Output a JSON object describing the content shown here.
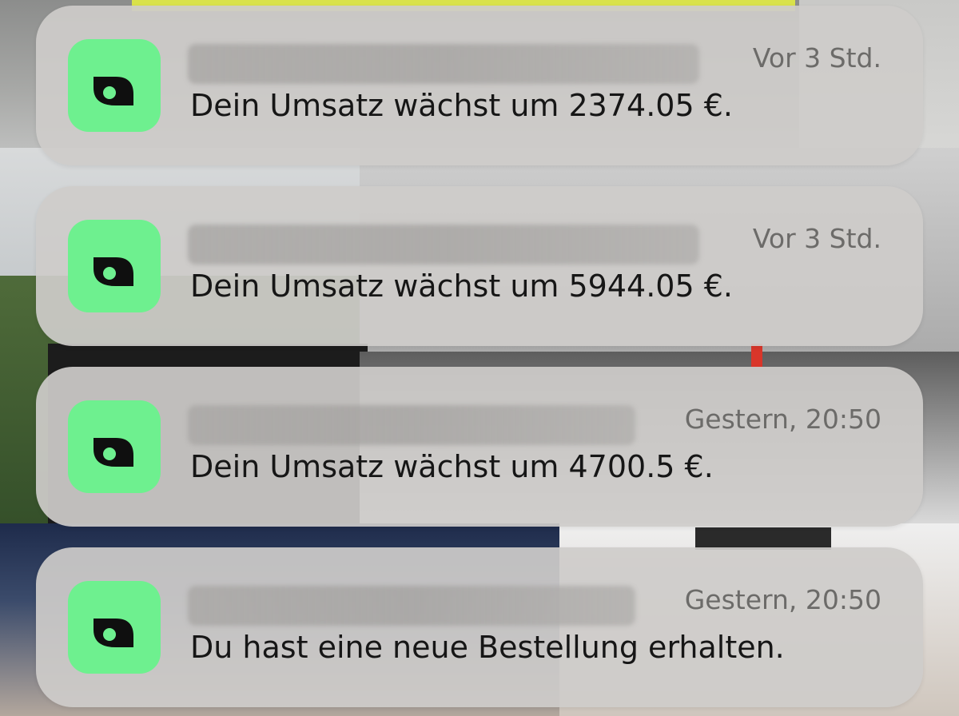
{
  "notifications": [
    {
      "app_icon": "shop-app-icon",
      "time": "Vor 3 Std.",
      "message": "Dein Umsatz wächst um 2374.05 €."
    },
    {
      "app_icon": "shop-app-icon",
      "time": "Vor 3 Std.",
      "message": "Dein Umsatz wächst um 5944.05 €."
    },
    {
      "app_icon": "shop-app-icon",
      "time": "Gestern, 20:50",
      "message": "Dein Umsatz wächst um 4700.5 €."
    },
    {
      "app_icon": "shop-app-icon",
      "time": "Gestern, 20:50",
      "message": "Du hast eine neue Bestellung erhalten."
    }
  ],
  "colors": {
    "icon_background": "#6ef08f",
    "icon_glyph": "#0f0f0f",
    "card_background": "#cecccaeb",
    "time_text": "#6c6b69",
    "message_text": "#161616"
  }
}
